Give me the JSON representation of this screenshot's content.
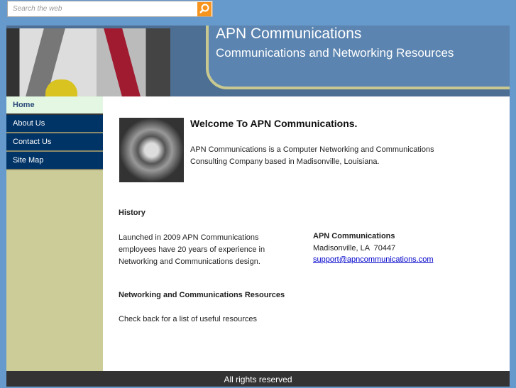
{
  "search": {
    "placeholder": "Search the web",
    "icon": "search-icon"
  },
  "header": {
    "title": "APN Communications",
    "subtitle": "Communications and Networking Resources"
  },
  "nav": [
    {
      "label": "Home"
    },
    {
      "label": "About Us"
    },
    {
      "label": "Contact Us"
    },
    {
      "label": "Site Map"
    }
  ],
  "main": {
    "welcome_heading": "Welcome To APN Communications.",
    "welcome_text": "APN Communications is a Computer Networking and Communications Consulting Company based in Madisonville, Louisiana.",
    "history_heading": "History",
    "history_text": "Launched in 2009 APN Communications employees have 20 years of experience in Networking and Communications design.",
    "contact": {
      "name": "APN Communications",
      "address": "Madisonville, LA  70447",
      "email": "support@apncommunications.com"
    },
    "resources_heading": "Networking and Communications Resources",
    "resources_text": "Check back for a list of useful resources"
  },
  "footer": {
    "text": "All rights reserved"
  }
}
